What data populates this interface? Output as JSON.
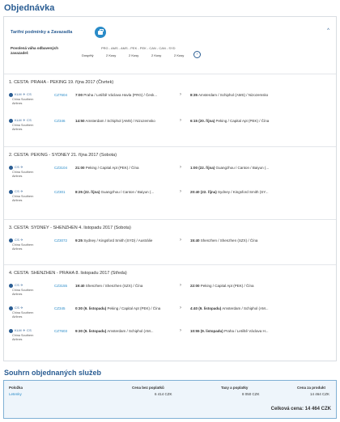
{
  "page": {
    "title": "Objednávka"
  },
  "tariff": {
    "title": "Tarifní podmínky a Zavazadla"
  },
  "baggage": {
    "label": "Povolená váha odbavených zavazadel:",
    "route": "PRG - AMS - AMS - PEK - PEK - CAN - CAN - SYD",
    "passenger": "Dospělý",
    "cells": [
      "2 Kusy",
      "2 Kusy",
      "2 Kusy",
      "2 Kusy"
    ]
  },
  "segments": [
    {
      "title": "1. CESTA: PRAHA - PEKING 19. října 2017 (Čtvrtek)",
      "flights": [
        {
          "airline_logo": "KLM ✈ CS",
          "airline_name": "China Southern Airlines",
          "flight_no": "CZ7604",
          "dep_time": "7:00",
          "dep_place": "Praha / Letiště Václava Havla (PRG) / Česk...",
          "arr_time": "8:35",
          "arr_place": "Amsterdam / Schiphol (AMS) / Nizozemsko"
        },
        {
          "airline_logo": "KLM ✈ CS",
          "airline_name": "China Southern Airlines",
          "flight_no": "CZ346",
          "dep_time": "14:50",
          "dep_place": "Amsterdam / Schiphol (AMS) / Nizozemsko",
          "arr_time": "6:15 (20. října)",
          "arr_place": "Peking / Capital Apt (PEK) / Čína"
        }
      ]
    },
    {
      "title": "2. CESTA: PEKING - SYDNEY 21. října 2017 (Sobota)",
      "flights": [
        {
          "airline_logo": "CS ✈",
          "airline_name": "China Southern Airlines",
          "flight_no": "CZ3104",
          "dep_time": "21:00",
          "dep_place": "Peking / Capital Apt (PEK) / Čína",
          "arr_time": "1:00 (22. října)",
          "arr_place": "Guangzhou / Canton / Baiyun (..."
        },
        {
          "airline_logo": "CS ✈",
          "airline_name": "China Southern Airlines",
          "flight_no": "CZ301",
          "dep_time": "8:25 (22. října)",
          "dep_place": "Guangzhou / Canton / Baiyun (...",
          "arr_time": "20:40 (22. října)",
          "arr_place": "Sydney / Kingsford Smith (SY..."
        }
      ]
    },
    {
      "title": "3. CESTA: SYDNEY - SHENZHEN 4. listopadu 2017 (Sobota)",
      "flights": [
        {
          "airline_logo": "CS ✈",
          "airline_name": "China Southern Airlines",
          "flight_no": "CZ3072",
          "dep_time": "9:25",
          "dep_place": "Sydney / Kingsford Smith (SYD) / Austrálie",
          "arr_time": "15:40",
          "arr_place": "Shenzhen / Shenzhen (SZX) / Čína"
        }
      ]
    },
    {
      "title": "4. CESTA: SHENZHEN - PRAHA 8. listopadu 2017 (Středa)",
      "flights": [
        {
          "airline_logo": "CS ✈",
          "airline_name": "China Southern Airlines",
          "flight_no": "CZ3155",
          "dep_time": "19:40",
          "dep_place": "Shenzhen / Shenzhen (SZX) / Čína",
          "arr_time": "22:00",
          "arr_place": "Peking / Capital Apt (PEK) / Čína"
        },
        {
          "airline_logo": "CS ✈",
          "airline_name": "China Southern Airlines",
          "flight_no": "CZ345",
          "dep_time": "0:30 (9. listopadu)",
          "dep_place": "Peking / Capital Apt (PEK) / Čína",
          "arr_time": "4:40 (9. listopadu)",
          "arr_place": "Amsterdam / Schiphol (AM..."
        },
        {
          "airline_logo": "KLM ✈ CS",
          "airline_name": "China Southern Airlines",
          "flight_no": "CZ7603",
          "dep_time": "9:30 (9. listopadu)",
          "dep_place": "Amsterdam / Schiphol (AM...",
          "arr_time": "10:55 (9. listopadu)",
          "arr_place": "Praha / Letiště Václava H..."
        }
      ]
    }
  ],
  "summary": {
    "title": "Souhrn objednaných služeb",
    "col_item": "Položka",
    "col_price": "Cena bez poplatků",
    "col_taxes": "Taxy a poplatky",
    "col_total": "Cena za produkt",
    "item": "Letenky",
    "price": "6 414 CZK",
    "taxes": "8 050 CZK",
    "product_total": "14 464 CZK",
    "total_label": "Celková cena: 14 464 CZK"
  },
  "colors": {
    "accent": "#2a5d93",
    "link": "#2a8bc8",
    "summary_bg": "#eef5fb"
  }
}
